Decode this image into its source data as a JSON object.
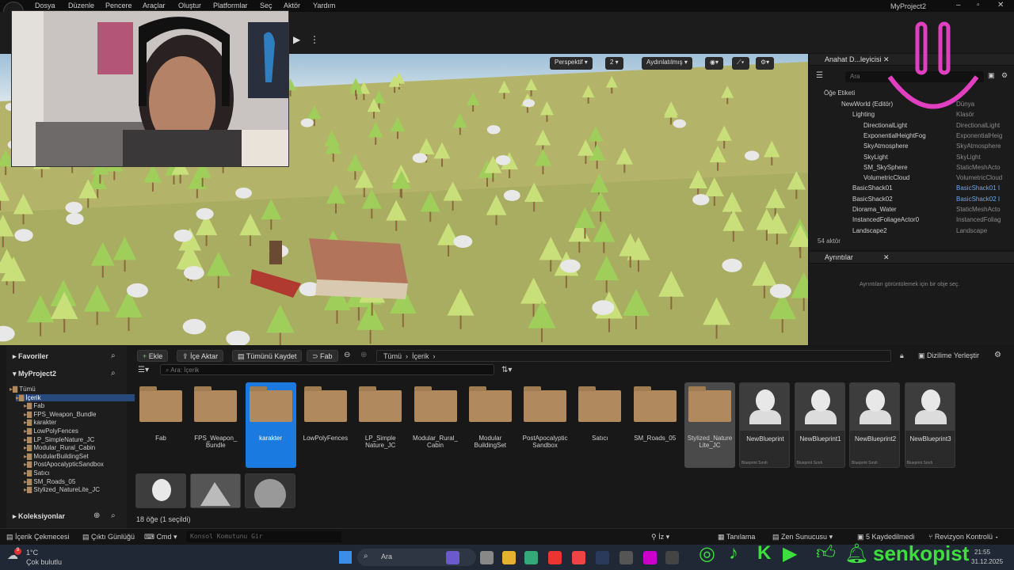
{
  "menu": [
    "Dosya",
    "Düzenle",
    "Pencere",
    "Araçlar",
    "Oluştur",
    "Platformlar",
    "Seç",
    "Aktör",
    "Yardım"
  ],
  "project_title": "MyProject2",
  "viewport": {
    "mode": "Perspektif",
    "lighting": "Aydınlatılmış",
    "num": "2"
  },
  "outliner": {
    "tab": "Anahat D...leyicisi",
    "search_placeholder": "Ara",
    "col_label": "Öğe Etiketi",
    "rows": [
      {
        "n": "NewWorld (Editör)",
        "t": "Dünya",
        "i": 0
      },
      {
        "n": "Lighting",
        "t": "Klasör",
        "i": 1
      },
      {
        "n": "DirectionalLight",
        "t": "DirectionalLight",
        "i": 2
      },
      {
        "n": "ExponentialHeightFog",
        "t": "ExponentialHeig",
        "i": 2
      },
      {
        "n": "SkyAtmosphere",
        "t": "SkyAtmosphere",
        "i": 2
      },
      {
        "n": "SkyLight",
        "t": "SkyLight",
        "i": 2
      },
      {
        "n": "SM_SkySphere",
        "t": "StaticMeshActo",
        "i": 2
      },
      {
        "n": "VolumetricCloud",
        "t": "VolumetricCloud",
        "i": 2
      },
      {
        "n": "BasicShack01",
        "t": "BasicShack01 I",
        "i": 1
      },
      {
        "n": "BasicShack02",
        "t": "BasicShack02 I",
        "i": 1
      },
      {
        "n": "Diorama_Water",
        "t": "StaticMeshActo",
        "i": 1
      },
      {
        "n": "InstancedFoliageActor0",
        "t": "InstancedFoliag",
        "i": 1
      },
      {
        "n": "Landscape2",
        "t": "Landscape",
        "i": 1
      }
    ],
    "count": "54 aktör"
  },
  "details": {
    "tab": "Ayrıntılar",
    "empty": "Ayrıntıları görüntülemek için bir obje seç."
  },
  "content": {
    "favorites": "Favoriler",
    "project": "MyProject2",
    "collections": "Koleksiyonlar",
    "tree": [
      "Tümü",
      "İçerik",
      "Fab",
      "FPS_Weapon_Bundle",
      "karakter",
      "LowPolyFences",
      "LP_SimpleNature_JC",
      "Modular_Rural_Cabin",
      "ModularBuildingSet",
      "PostApocalypticSandbox",
      "Satıcı",
      "SM_Roads_05",
      "Stylized_NatureLite_JC"
    ],
    "buttons": {
      "add": "Ekle",
      "import": "İçe Aktar",
      "save_all": "Tümünü Kaydet",
      "fab": "Fab",
      "dock": "Dizilime Yerleştir"
    },
    "path": [
      "Tümü",
      "İçerik"
    ],
    "search_placeholder": "Ara: İçerik",
    "folders": [
      "Fab",
      "FPS_Weapon_\nBundle",
      "karakter",
      "LowPolyFences",
      "LP_Simple\nNature_JC",
      "Modular_Rural_\nCabin",
      "Modular\nBuildingSet",
      "PostApocalyptic\nSandbox",
      "Satıcı",
      "SM_Roads_05",
      "Stylized_Nature\nLite_JC"
    ],
    "blueprints": [
      "NewBlueprint",
      "NewBlueprint1",
      "NewBlueprint2",
      "NewBlueprint3"
    ],
    "bp_sub": "Blueprint Sınıfı",
    "count": "18 öğe (1 seçildi)"
  },
  "status": {
    "drawer": "İçerik Çekmecesi",
    "log": "Çıktı Günlüğü",
    "cmd": "Cmd",
    "console_placeholder": "Konsol Komutunu Gir",
    "trace": "İz",
    "derive": "Tanılama",
    "zen": "Zen Sunucusu",
    "saved": "5 Kaydedilmedi",
    "rev": "Revizyon Kontrolü"
  },
  "taskbar": {
    "temp": "1°C",
    "weather": "Çok bulutlu",
    "search": "Ara",
    "time": "21:55",
    "date": "31.12.2025",
    "brand": "senkopist",
    "badge": "9"
  }
}
